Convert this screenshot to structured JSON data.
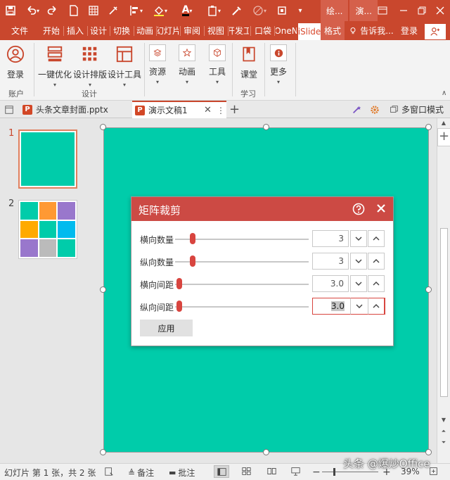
{
  "titlebar": {
    "context_tab_1": "绘...",
    "context_tab_2": "演..."
  },
  "tabs": [
    "文件",
    "开始",
    "插入",
    "设计",
    "切换",
    "动画",
    "幻灯片",
    "审阅",
    "视图",
    "开发工",
    "口袋",
    "OneN",
    "iSlide",
    "格式"
  ],
  "tell_me": "告诉我...",
  "login": "登录",
  "ribbon": {
    "login": "登录",
    "one_click": "一键优化",
    "design_layout": "设计排版",
    "design_tools": "设计工具",
    "resources": "资源",
    "animation": "动画",
    "tools": "工具",
    "classroom": "课堂",
    "more": "更多",
    "group_account": "账户",
    "group_design": "设计",
    "group_learn": "学习"
  },
  "doc_tabs": {
    "file1": "头条文章封面.pptx",
    "file2": "演示文稿1",
    "multi_window": "多窗口模式"
  },
  "thumbnails": {
    "slide1_num": "1",
    "slide2_num": "2",
    "slide1_color": "#00ccaa",
    "slide2_colors": [
      "#00ccaa",
      "#ff9933",
      "#9977cc",
      "#ffaa00",
      "#00ccaa",
      "#00bbee",
      "#9977cc",
      "#bbbbbb",
      "#00ccaa"
    ]
  },
  "dialog": {
    "title": "矩阵裁剪",
    "rows": [
      {
        "label": "横向数量",
        "value": "3",
        "slider_fraction": 0.12
      },
      {
        "label": "纵向数量",
        "value": "3",
        "slider_fraction": 0.12
      },
      {
        "label": "横向间距",
        "value": "3.0",
        "slider_fraction": 0.02
      },
      {
        "label": "纵向间距",
        "value": "3.0",
        "slider_fraction": 0.02
      }
    ],
    "apply": "应用",
    "accent": "#cc4a44"
  },
  "statusbar": {
    "slide_info": "幻灯片 第 1 张，共 2 张",
    "notes": "备注",
    "comments": "批注",
    "zoom": "39%",
    "watermark": "头条 @爆炒Office"
  }
}
